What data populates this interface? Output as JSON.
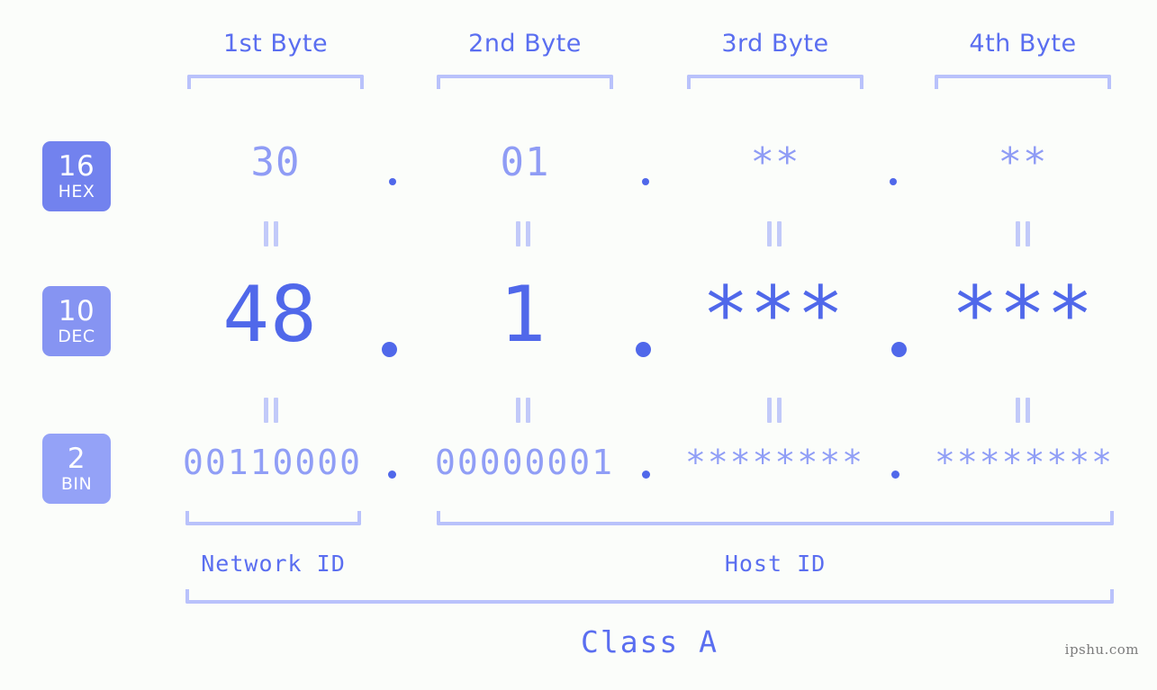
{
  "background": "#fbfdfa",
  "accent_dark": "#5068ea",
  "accent_mid": "#5a6ef0",
  "accent_light": "#8f9cf5",
  "accent_pale": "#b9c2fb",
  "byte_headers": [
    {
      "label": "1st Byte"
    },
    {
      "label": "2nd Byte"
    },
    {
      "label": "3rd Byte"
    },
    {
      "label": "4th Byte"
    }
  ],
  "bases": [
    {
      "number": "16",
      "name": "HEX",
      "color": "#7282ee"
    },
    {
      "number": "10",
      "name": "DEC",
      "color": "#8694f2"
    },
    {
      "number": "2",
      "name": "BIN",
      "color": "#94a2f7"
    }
  ],
  "rows": {
    "hex": {
      "values": [
        "30",
        "01",
        "**",
        "**"
      ]
    },
    "dec": {
      "values": [
        "48",
        "1",
        "***",
        "***"
      ]
    },
    "bin": {
      "values": [
        "00110000",
        "00000001",
        "********",
        "********"
      ]
    }
  },
  "separators": {
    "dot": "."
  },
  "equals": {
    "glyph": "||"
  },
  "segments": {
    "network_id": "Network ID",
    "host_id": "Host ID"
  },
  "class": {
    "label": "Class A"
  },
  "watermark": {
    "text": "ipshu.com"
  }
}
